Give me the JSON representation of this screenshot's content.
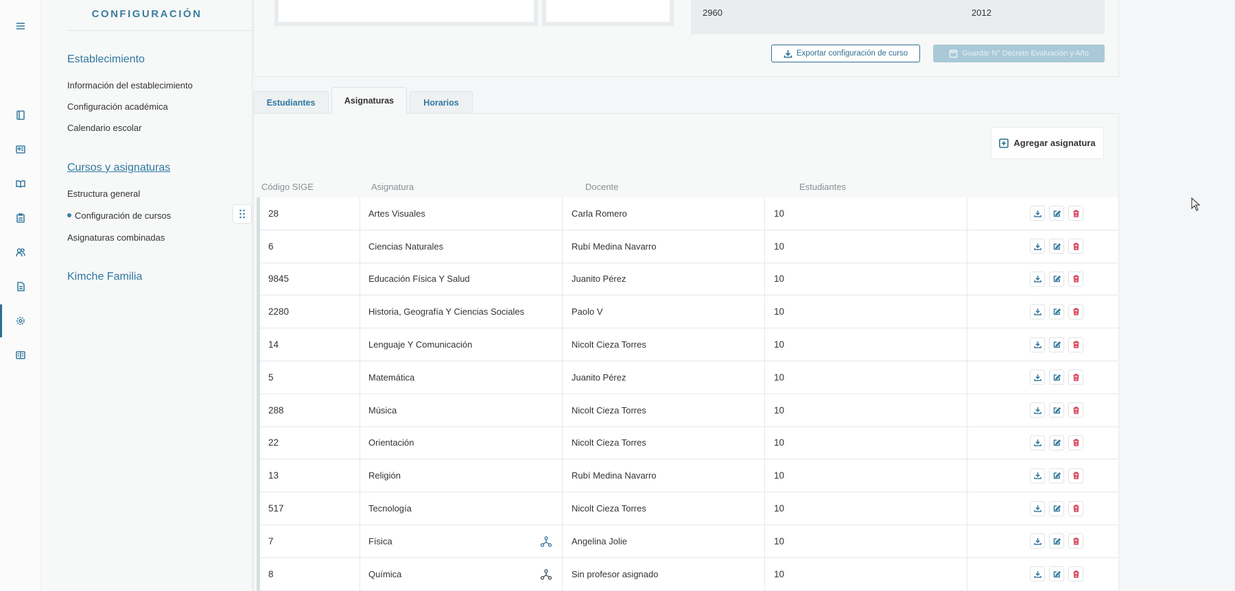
{
  "sidebar": {
    "title": "CONFIGURACIÓN",
    "section_establecimiento": "Establecimiento",
    "links_establecimiento": [
      "Información del establecimiento",
      "Configuración académica",
      "Calendario escolar"
    ],
    "section_cursos": "Cursos y asignaturas",
    "links_cursos": [
      "Estructura general",
      "Configuración de cursos",
      "Asignaturas combinadas"
    ],
    "section_familia": "Kimche Familia"
  },
  "top_card": {
    "value_1": "2960",
    "value_2": "2012",
    "export_label": "Exportar configuración de curso",
    "save_label": "Guardar N° Decreto Evaluación y Año"
  },
  "tabs": [
    "Estudiantes",
    "Asignaturas",
    "Horarios"
  ],
  "active_tab": "Asignaturas",
  "add_button_label": "Agregar asignatura",
  "table": {
    "headers": [
      "Código SIGE",
      "Asignatura",
      "Docente",
      "Estudiantes"
    ],
    "rows": [
      {
        "code": "28",
        "name": "Artes Visuales",
        "teacher": "Carla Romero",
        "students": "10"
      },
      {
        "code": "6",
        "name": "Ciencias Naturales",
        "teacher": "Rubí Medina Navarro",
        "students": "10"
      },
      {
        "code": "9845",
        "name": "Educación Física Y Salud",
        "teacher": "Juanito Pérez",
        "students": "10"
      },
      {
        "code": "2280",
        "name": "Historia, Geografía Y Ciencias Sociales",
        "teacher": "Paolo V",
        "students": "10"
      },
      {
        "code": "14",
        "name": "Lenguaje Y Comunicación",
        "teacher": "Nicolt Cieza Torres",
        "students": "10"
      },
      {
        "code": "5",
        "name": "Matemática",
        "teacher": "Juanito Pérez",
        "students": "10"
      },
      {
        "code": "288",
        "name": "Música",
        "teacher": "Nicolt Cieza Torres",
        "students": "10"
      },
      {
        "code": "22",
        "name": "Orientación",
        "teacher": "Nicolt Cieza Torres",
        "students": "10"
      },
      {
        "code": "13",
        "name": "Religión",
        "teacher": "Rubí Medina Navarro",
        "students": "10"
      },
      {
        "code": "517",
        "name": "Tecnología",
        "teacher": "Nicolt Cieza Torres",
        "students": "10"
      },
      {
        "code": "7",
        "name": "Física",
        "teacher": "Angelina Jolie",
        "students": "10",
        "combined": true
      },
      {
        "code": "8",
        "name": "Química",
        "teacher": "Sin profesor asignado",
        "students": "10",
        "combined": true
      }
    ]
  },
  "icons": {
    "rail": [
      "menu-icon",
      "book-icon",
      "id-card-icon",
      "open-book-icon",
      "clipboard-icon",
      "users-icon",
      "document-icon",
      "gear-icon",
      "manual-icon"
    ],
    "row_actions": [
      "download-icon",
      "edit-icon",
      "trash-icon"
    ],
    "combined": "merge-icon"
  },
  "colors": {
    "accent": "#2f78a0",
    "delete": "#d6455b",
    "disabled_button": "#a9c9d8"
  }
}
